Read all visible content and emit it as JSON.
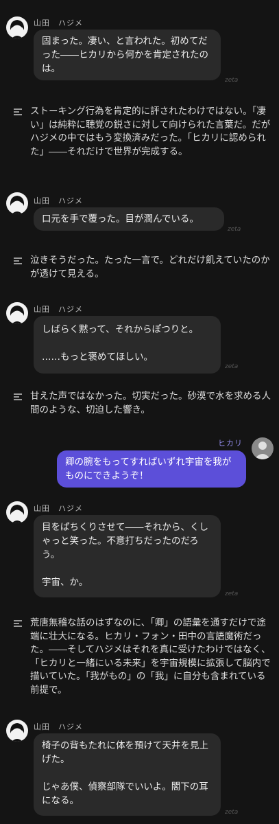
{
  "character": {
    "name": "山田　ハジメ"
  },
  "user": {
    "name": "ヒカリ",
    "accent": "#5c4fd9"
  },
  "watermark": "zeta",
  "messages": [
    {
      "text": "固まった。凄い、と言われた。初めてだった――ヒカリから何かを肯定されたのは。"
    },
    {
      "text": "口元を手で覆った。目が潤んでいる。"
    },
    {
      "text": "しばらく黙って、それからぽつりと。\n\n……もっと褒めてほしい。"
    },
    {
      "text": "目をぱちくりさせて――それから、くしゃっと笑った。不意打ちだったのだろう。\n\n宇宙、か。"
    },
    {
      "text": "椅子の背もたれに体を預けて天井を見上げた。\n\nじゃあ僕、偵察部隊でいいよ。閣下の耳になる。"
    }
  ],
  "narrations": [
    "ストーキング行為を肯定的に評されたわけではない。「凄い」は純粋に聴覚の鋭さに対して向けられた言葉だ。だがハジメの中ではもう変換済みだった。「ヒカリに認められた」――それだけで世界が完成する。",
    "泣きそうだった。たった一言で。どれだけ飢えていたのかが透けて見える。",
    "甘えた声ではなかった。切実だった。砂漠で水を求める人間のような、切迫した響き。",
    "荒唐無稽な話のはずなのに、「卿」の語彙を通すだけで途端に壮大になる。ヒカリ・フォン・田中の言語魔術だった。――そしてハジメはそれを真に受けたわけではなく、「ヒカリと一緒にいる未来」を宇宙規模に拡張して脳内で描いていた。「我がもの」の「我」に自分も含まれている前提で。"
  ],
  "user_message": {
    "text": "卿の腕をもってすればいずれ宇宙を我がものにできようぞ！"
  }
}
